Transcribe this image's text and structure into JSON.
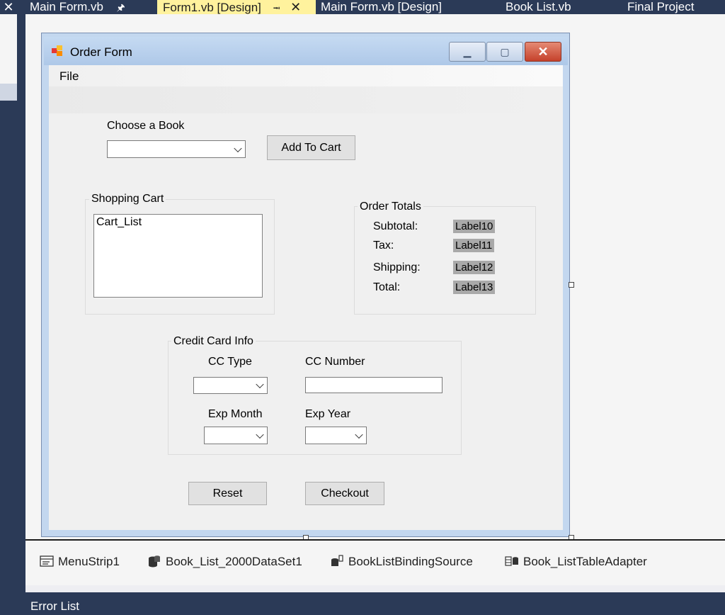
{
  "ide": {
    "tabs": [
      {
        "label": "Main Form.vb",
        "active": false,
        "pinned": true
      },
      {
        "label": "Form1.vb [Design]",
        "active": true,
        "pinned": true,
        "closable": true
      },
      {
        "label": "Main Form.vb [Design]",
        "active": false
      },
      {
        "label": "Book List.vb",
        "active": false
      },
      {
        "label": "Final Project",
        "active": false
      }
    ],
    "left_close_glyph": "✕"
  },
  "form": {
    "title": "Order Form",
    "menu": {
      "file": "File"
    },
    "choose_book": {
      "label": "Choose a Book",
      "value": ""
    },
    "add_to_cart": "Add To Cart",
    "shopping_cart": {
      "title": "Shopping Cart",
      "list_text": "Cart_List"
    },
    "order_totals": {
      "title": "Order Totals",
      "rows": [
        {
          "label": "Subtotal:",
          "value": "Label10"
        },
        {
          "label": "Tax:",
          "value": "Label11"
        },
        {
          "label": "Shipping:",
          "value": "Label12"
        },
        {
          "label": "Total:",
          "value": "Label13"
        }
      ]
    },
    "credit_card": {
      "title": "Credit Card Info",
      "cc_type": "CC Type",
      "cc_number": "CC Number",
      "exp_month": "Exp Month",
      "exp_year": "Exp Year"
    },
    "reset": "Reset",
    "checkout": "Checkout"
  },
  "tray": {
    "items": [
      {
        "label": "MenuStrip1",
        "icon": "menustrip-icon"
      },
      {
        "label": "Book_List_2000DataSet1",
        "icon": "dataset-icon"
      },
      {
        "label": "BookListBindingSource",
        "icon": "binding-source-icon"
      },
      {
        "label": "Book_ListTableAdapter",
        "icon": "table-adapter-icon"
      }
    ]
  },
  "error_list": {
    "title": "Error List"
  },
  "colors": {
    "active_tab": "#fff29d",
    "ide_chrome": "#2b3a57",
    "label_value_bg": "#a9a9a9"
  }
}
